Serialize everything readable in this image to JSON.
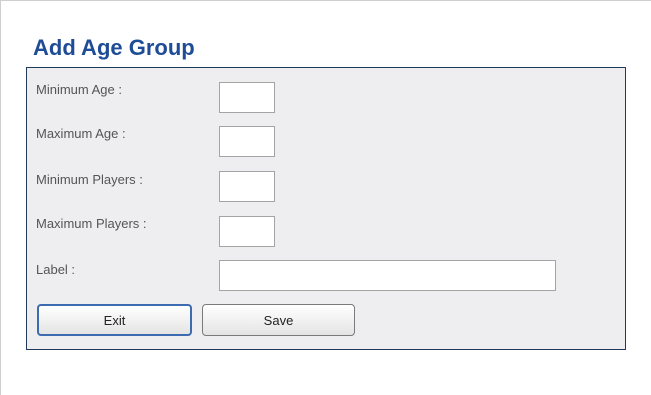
{
  "form": {
    "title": "Add Age Group",
    "fields": [
      {
        "label": "Minimum Age :",
        "value": ""
      },
      {
        "label": "Maximum Age :",
        "value": ""
      },
      {
        "label": "Minimum Players :",
        "value": ""
      },
      {
        "label": "Maximum Players :",
        "value": ""
      },
      {
        "label": "Label :",
        "value": ""
      }
    ],
    "buttons": {
      "exit_label": "Exit",
      "save_label": "Save"
    }
  },
  "colors": {
    "title": "#1f4c96",
    "panel_background": "#eeeef0",
    "panel_border": "#203a5a",
    "focused_button_border": "#3d6bb0"
  }
}
